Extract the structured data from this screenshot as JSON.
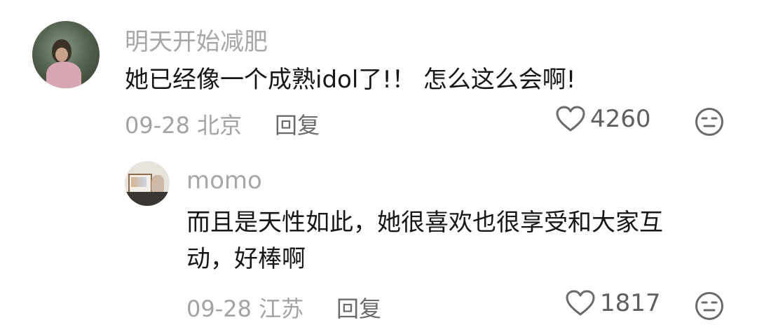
{
  "comments": [
    {
      "username": "明天开始减肥",
      "content": "她已经像一个成熟idol了!！ 怎么这么会啊!",
      "meta": "09-28 北京",
      "reply_label": "回复",
      "likes": "4260",
      "avatar_icon": "user-avatar",
      "like_icon": "heart-outline-icon",
      "dislike_icon": "meh-face-icon"
    },
    {
      "username": "momo",
      "content": "而且是天性如此，她很喜欢也很享受和大家互\n动，好棒啊",
      "meta": "09-28 江苏",
      "reply_label": "回复",
      "likes": "1817",
      "avatar_icon": "user-avatar",
      "like_icon": "heart-outline-icon",
      "dislike_icon": "meh-face-icon"
    }
  ],
  "colors": {
    "username": "#a7a7a7",
    "content": "#161616",
    "meta": "#a3a3a3",
    "reply": "#6b6b6b",
    "icon": "#6a6a6a"
  }
}
